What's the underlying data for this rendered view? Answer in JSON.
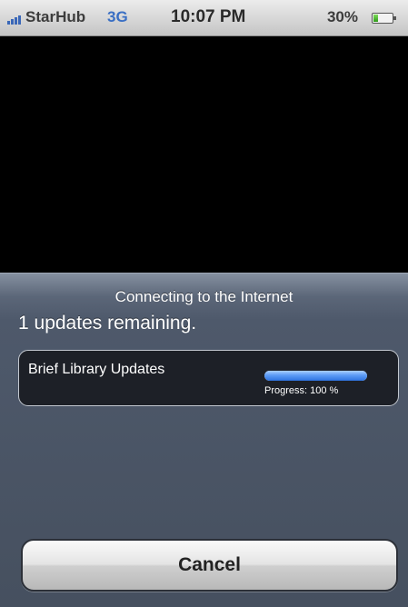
{
  "status_bar": {
    "carrier": "StarHub",
    "network": "3G",
    "time": "10:07 PM",
    "battery_percent": "30%",
    "battery_level": 0.3,
    "icons": [
      "signal-bars-icon",
      "battery-icon"
    ]
  },
  "sheet": {
    "title": "Connecting to the Internet",
    "updates_remaining": "1 updates remaining.",
    "panel": {
      "label": "Brief Library Updates",
      "progress_value": 1.0,
      "progress_text": "Progress: 100 %"
    },
    "cancel_label": "Cancel"
  },
  "colors": {
    "accent_blue": "#3a6fc4",
    "progress_blue": "#2f73e0",
    "sheet_bg": "#4e596b"
  }
}
